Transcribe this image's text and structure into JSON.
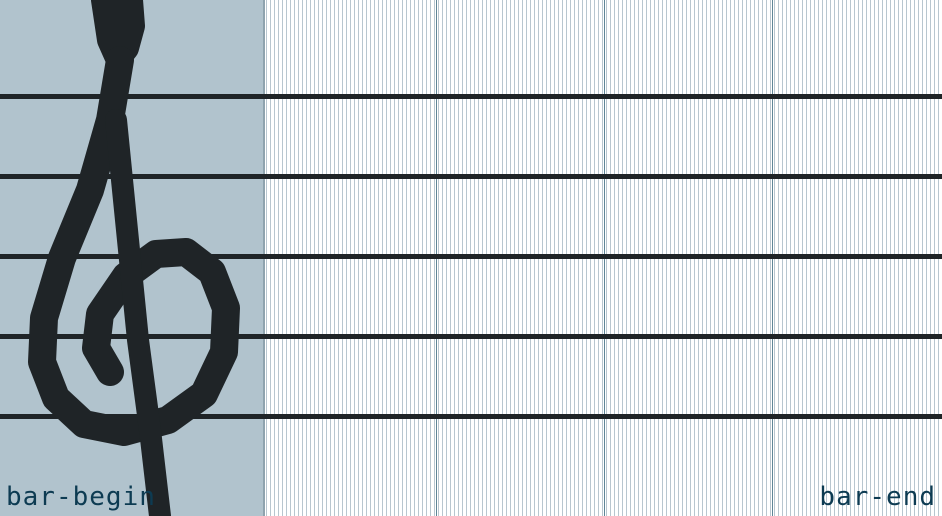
{
  "colors": {
    "clef_area_bg": "#b1c3cd",
    "staff_line": "#1f2427",
    "clef_glyph": "#1f2427",
    "beat_line": "#5f8596",
    "label_text": "#0d3b52"
  },
  "staff": {
    "line_count": 5,
    "icon": "treble-clef-icon"
  },
  "grid": {
    "beats_visible": 4
  },
  "labels": {
    "bar_begin": "bar-begin",
    "bar_end": "bar-end"
  }
}
